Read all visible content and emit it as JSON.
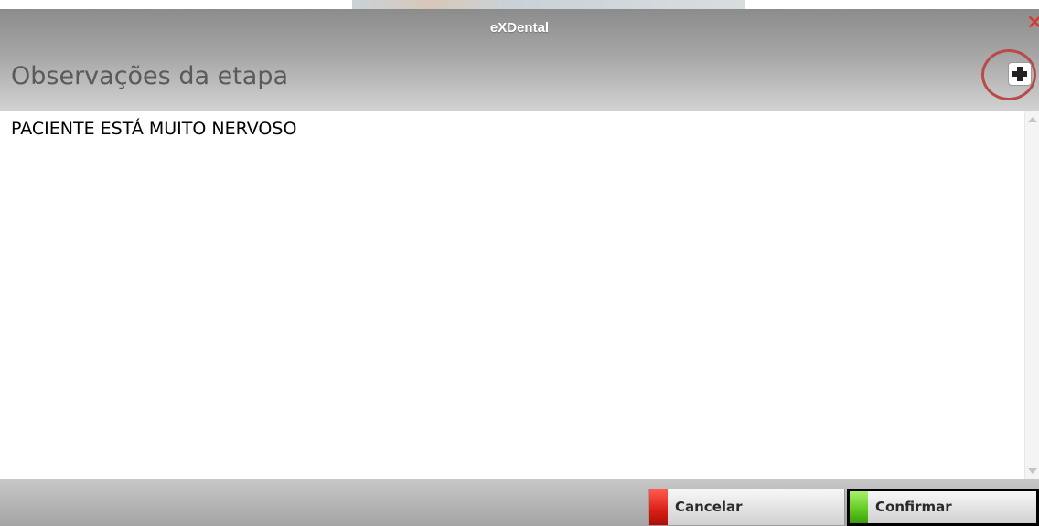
{
  "window": {
    "app_title": "eXDental",
    "close_glyph": "✕"
  },
  "dialog": {
    "title": "Observações da etapa",
    "add_icon": "plus-icon"
  },
  "notes": {
    "value": "PACIENTE ESTÁ MUITO NERVOSO"
  },
  "footer": {
    "cancel_label": "Cancelar",
    "confirm_label": "Confirmar"
  },
  "colors": {
    "close": "#e0312b",
    "cancel_stripe": "#d81f14",
    "confirm_stripe": "#5cc91e",
    "highlight_circle": "#b94a4a"
  }
}
